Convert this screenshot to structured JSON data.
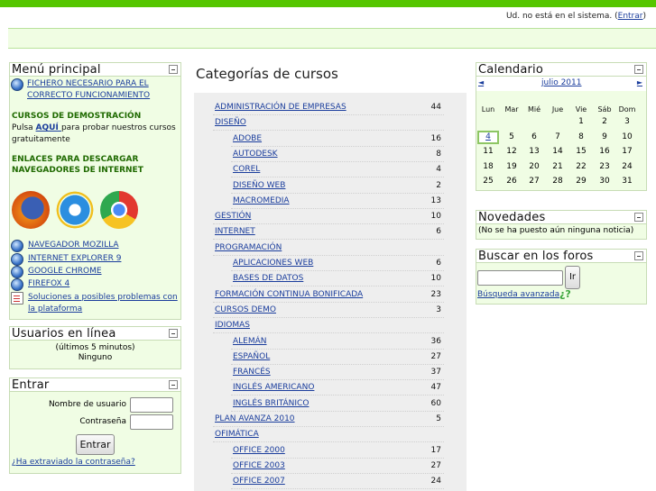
{
  "header": {
    "login_prefix": "Ud. no está en el sistema. (",
    "login_link": "Entrar",
    "login_suffix": ")"
  },
  "main_menu": {
    "title": "Menú principal",
    "required_file_link": "FICHERO NECESARIO PARA EL CORRECTO FUNCIONAMIENTO",
    "demo_heading": "CURSOS DE DEMOSTRACIÓN",
    "demo_text_before": "Pulsa ",
    "demo_link": "AQUÍ ",
    "demo_text_after": "para probar nuestros cursos gratuitamente",
    "browsers_heading": "ENLACES PARA DESCARGAR NAVEGADORES DE INTERNET",
    "links": [
      {
        "label": "NAVEGADOR MOZILLA",
        "icon": "globe-icon"
      },
      {
        "label": "INTERNET EXPLORER 9",
        "icon": "globe-icon"
      },
      {
        "label": "GOOGLE CHROME",
        "icon": "globe-icon"
      },
      {
        "label": "FIREFOX 4",
        "icon": "globe-icon"
      },
      {
        "label": "Soluciones a posibles problemas con la plataforma",
        "icon": "document-icon"
      }
    ]
  },
  "online_users": {
    "title": "Usuarios en línea",
    "period": "(últimos 5 minutos)",
    "value": "Ninguno"
  },
  "login": {
    "title": "Entrar",
    "username_label": "Nombre de usuario",
    "password_label": "Contraseña",
    "button": "Entrar",
    "forgot_link": "¿Ha extraviado la contraseña?"
  },
  "categories": {
    "title": "Categorías de cursos",
    "items": [
      {
        "name": "ADMINISTRACIÓN DE EMPRESAS",
        "count": "44",
        "level": 0
      },
      {
        "name": "DISEÑO",
        "count": "",
        "level": 0
      },
      {
        "name": "ADOBE",
        "count": "16",
        "level": 1
      },
      {
        "name": "AUTODESK",
        "count": "8",
        "level": 1
      },
      {
        "name": "COREL",
        "count": "4",
        "level": 1
      },
      {
        "name": "DISEÑO WEB",
        "count": "2",
        "level": 1
      },
      {
        "name": "MACROMEDIA",
        "count": "13",
        "level": 1
      },
      {
        "name": "GESTIÓN",
        "count": "10",
        "level": 0
      },
      {
        "name": "INTERNET",
        "count": "6",
        "level": 0
      },
      {
        "name": "PROGRAMACIÓN",
        "count": "",
        "level": 0
      },
      {
        "name": "APLICACIONES WEB",
        "count": "6",
        "level": 1
      },
      {
        "name": "BASES DE DATOS",
        "count": "10",
        "level": 1
      },
      {
        "name": "FORMACIÓN CONTINUA BONIFICADA",
        "count": "23",
        "level": 0
      },
      {
        "name": "CURSOS DEMO",
        "count": "3",
        "level": 0
      },
      {
        "name": "IDIOMAS",
        "count": "",
        "level": 0
      },
      {
        "name": "ALEMÁN",
        "count": "36",
        "level": 1
      },
      {
        "name": "ESPAÑOL",
        "count": "27",
        "level": 1
      },
      {
        "name": "FRANCÉS",
        "count": "37",
        "level": 1
      },
      {
        "name": "INGLÉS AMERICANO",
        "count": "47",
        "level": 1
      },
      {
        "name": "INGLÉS BRITÁNICO",
        "count": "60",
        "level": 1
      },
      {
        "name": "PLAN AVANZA 2010",
        "count": "5",
        "level": 0
      },
      {
        "name": "OFIMÁTICA",
        "count": "",
        "level": 0
      },
      {
        "name": "OFFICE 2000",
        "count": "17",
        "level": 1
      },
      {
        "name": "OFFICE 2003",
        "count": "27",
        "level": 1
      },
      {
        "name": "OFFICE 2007",
        "count": "24",
        "level": 1
      }
    ]
  },
  "calendar": {
    "title": "Calendario",
    "prev": "◄",
    "next": "►",
    "month": "julio 2011",
    "weekdays": [
      "Lun",
      "Mar",
      "Mié",
      "Jue",
      "Vie",
      "Sáb",
      "Dom"
    ],
    "weeks": [
      [
        "",
        "",
        "",
        "",
        "1",
        "2",
        "3"
      ],
      [
        "4",
        "5",
        "6",
        "7",
        "8",
        "9",
        "10"
      ],
      [
        "11",
        "12",
        "13",
        "14",
        "15",
        "16",
        "17"
      ],
      [
        "18",
        "19",
        "20",
        "21",
        "22",
        "23",
        "24"
      ],
      [
        "25",
        "26",
        "27",
        "28",
        "29",
        "30",
        "31"
      ]
    ],
    "today": "4"
  },
  "news": {
    "title": "Novedades",
    "text": "(No se ha puesto aún ninguna noticia)"
  },
  "forum_search": {
    "title": "Buscar en los foros",
    "button": "Ir",
    "advanced_link": "Búsqueda avanzada",
    "help_icon": "¿?"
  },
  "colors": {
    "top_bar": "#55c600",
    "block_bg": "#f0fde4",
    "link": "#1a3d9c",
    "heading_green": "#1f6a00"
  }
}
